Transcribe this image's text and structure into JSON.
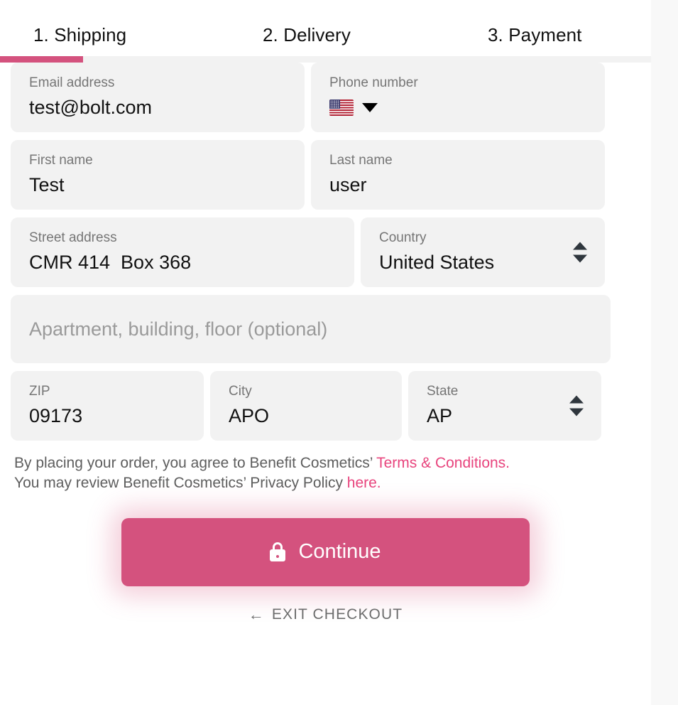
{
  "theme": {
    "accent": "#d4527e",
    "link": "#e8447d",
    "field_bg": "#f2f2f2",
    "panel_bg": "#f8f8f8",
    "text": "#111111",
    "label": "#767676"
  },
  "steps": {
    "items": [
      {
        "label": "1. Shipping",
        "active": true
      },
      {
        "label": "2. Delivery",
        "active": false
      },
      {
        "label": "3. Payment",
        "active": false
      }
    ],
    "progress_percent": 13
  },
  "form": {
    "email": {
      "label": "Email address",
      "value": "test@bolt.com",
      "placeholder": "Email address"
    },
    "phone": {
      "label": "Phone number",
      "value": "",
      "placeholder": "Phone number",
      "country_flag": "us-flag-icon",
      "dropdown_icon": "caret-down-icon"
    },
    "first_name": {
      "label": "First name",
      "value": "Test",
      "placeholder": "First name"
    },
    "last_name": {
      "label": "Last name",
      "value": "user",
      "placeholder": "Last name"
    },
    "street": {
      "label": "Street address",
      "value": "CMR 414  Box 368",
      "placeholder": "Street address"
    },
    "country": {
      "label": "Country",
      "value": "United States",
      "options": [
        "United States"
      ],
      "stepper_icon": "up-down-arrows-icon"
    },
    "apartment": {
      "label": "",
      "value": "",
      "placeholder": "Apartment, building, floor (optional)"
    },
    "zip": {
      "label": "ZIP",
      "value": "09173",
      "placeholder": "ZIP"
    },
    "city": {
      "label": "City",
      "value": "APO",
      "placeholder": "City"
    },
    "state": {
      "label": "State",
      "value": "AP",
      "options": [
        "AP"
      ],
      "stepper_icon": "up-down-arrows-icon"
    }
  },
  "legal": {
    "line1_prefix": "By placing your order, you agree to Benefit Cosmetics’ ",
    "terms_link": "Terms & Conditions.",
    "line2_prefix": "You may review Benefit Cosmetics’ Privacy Policy ",
    "here_link": "here."
  },
  "actions": {
    "continue_label": "Continue",
    "continue_icon": "lock-icon",
    "exit_label": "EXIT CHECKOUT",
    "exit_icon": "arrow-left-icon",
    "exit_arrow": "←"
  }
}
